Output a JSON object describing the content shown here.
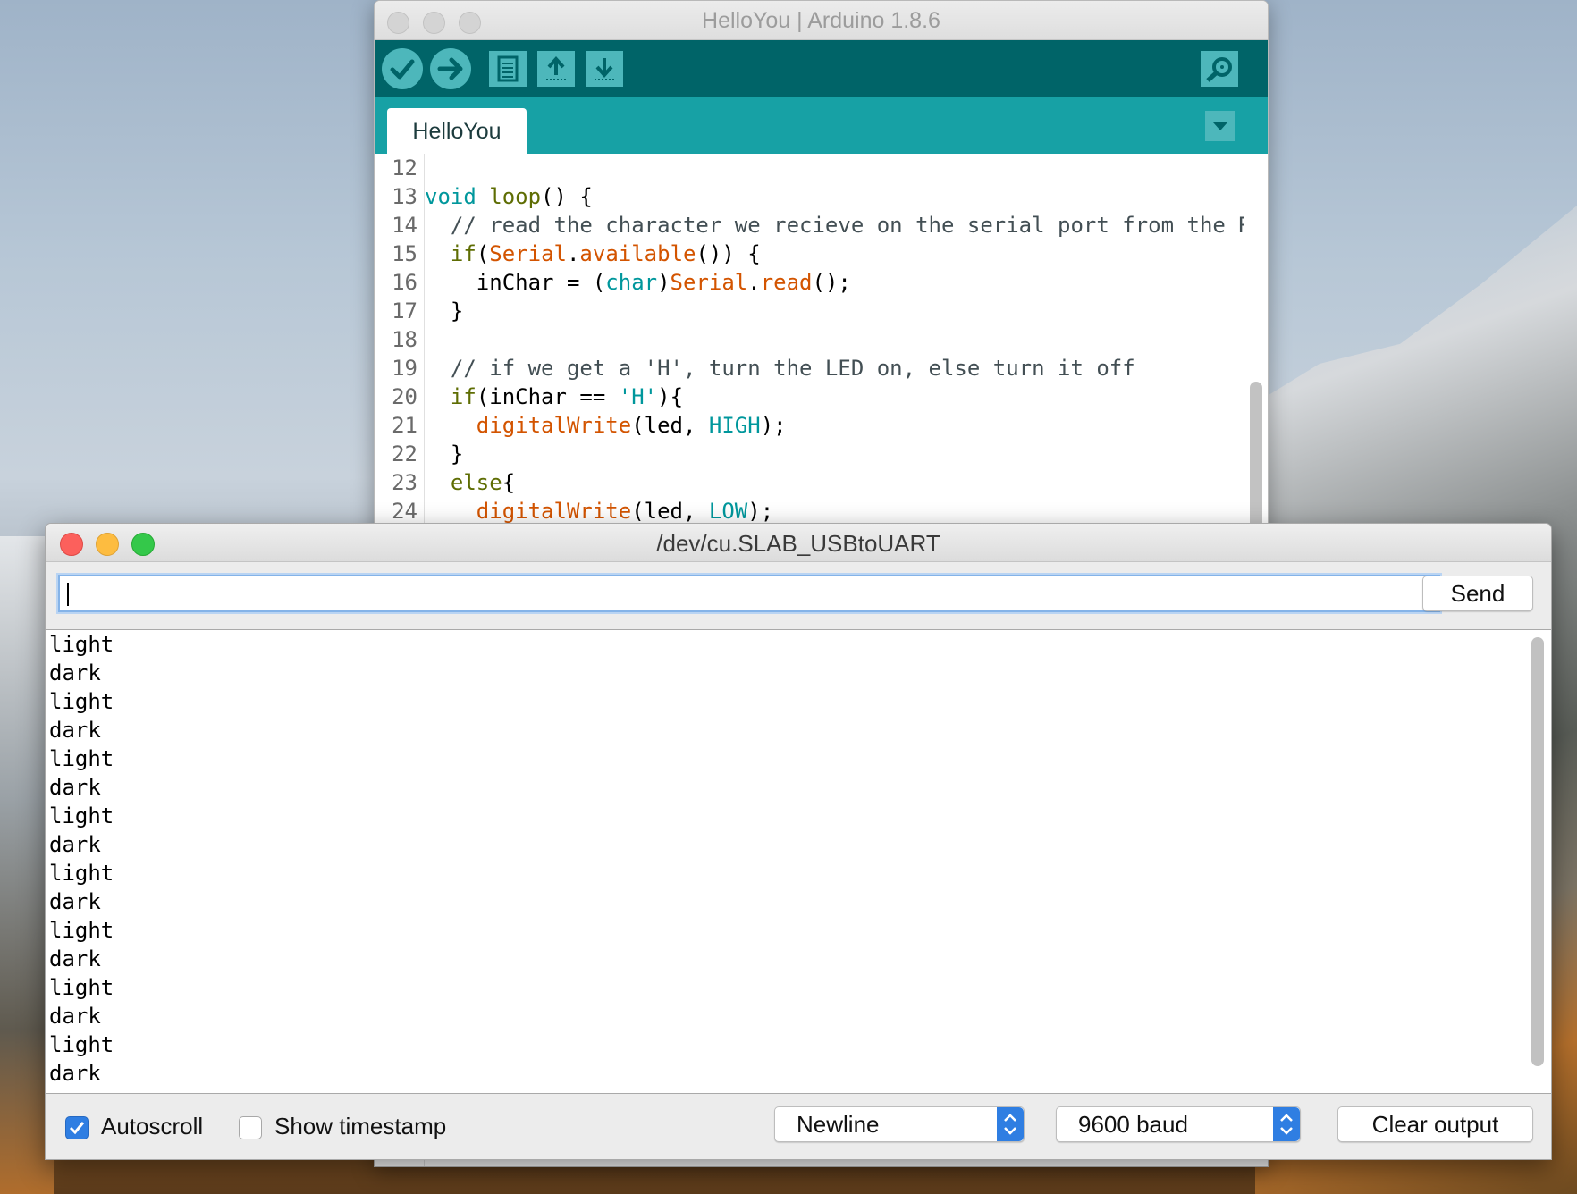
{
  "arduino": {
    "window_title": "HelloYou | Arduino 1.8.6",
    "tab_label": "HelloYou",
    "toolbar": {
      "verify_icon": "checkmark-icon",
      "upload_icon": "right-arrow-icon",
      "new_icon": "new-sketch-icon",
      "open_icon": "open-up-arrow-icon",
      "save_icon": "save-down-arrow-icon",
      "serial_monitor_icon": "magnifier-icon"
    },
    "line_numbers": [
      "12",
      "13",
      "14",
      "15",
      "16",
      "17",
      "18",
      "19",
      "20",
      "21",
      "22",
      "23",
      "24"
    ],
    "code_lines": [
      [
        {
          "t": "",
          "c": "pl"
        }
      ],
      [
        {
          "t": "void",
          "c": "ty"
        },
        {
          "t": " ",
          "c": "pl"
        },
        {
          "t": "loop",
          "c": "kw"
        },
        {
          "t": "() {",
          "c": "pl"
        }
      ],
      [
        {
          "t": "  // read the character we recieve on the serial port from the RP",
          "c": "cm"
        }
      ],
      [
        {
          "t": "  ",
          "c": "pl"
        },
        {
          "t": "if",
          "c": "kw"
        },
        {
          "t": "(",
          "c": "pl"
        },
        {
          "t": "Serial",
          "c": "fn"
        },
        {
          "t": ".",
          "c": "pl"
        },
        {
          "t": "available",
          "c": "fn"
        },
        {
          "t": "()) {",
          "c": "pl"
        }
      ],
      [
        {
          "t": "    inChar = (",
          "c": "pl"
        },
        {
          "t": "char",
          "c": "ty"
        },
        {
          "t": ")",
          "c": "pl"
        },
        {
          "t": "Serial",
          "c": "fn"
        },
        {
          "t": ".",
          "c": "pl"
        },
        {
          "t": "read",
          "c": "fn"
        },
        {
          "t": "();",
          "c": "pl"
        }
      ],
      [
        {
          "t": "  }",
          "c": "pl"
        }
      ],
      [
        {
          "t": "",
          "c": "pl"
        }
      ],
      [
        {
          "t": "  // if we get a 'H', turn the LED on, else turn it off",
          "c": "cm"
        }
      ],
      [
        {
          "t": "  ",
          "c": "pl"
        },
        {
          "t": "if",
          "c": "kw"
        },
        {
          "t": "(inChar == ",
          "c": "pl"
        },
        {
          "t": "'H'",
          "c": "ty"
        },
        {
          "t": "){",
          "c": "pl"
        }
      ],
      [
        {
          "t": "    ",
          "c": "pl"
        },
        {
          "t": "digitalWrite",
          "c": "fn"
        },
        {
          "t": "(led, ",
          "c": "pl"
        },
        {
          "t": "HIGH",
          "c": "ty"
        },
        {
          "t": ");",
          "c": "pl"
        }
      ],
      [
        {
          "t": "  }",
          "c": "pl"
        }
      ],
      [
        {
          "t": "  ",
          "c": "pl"
        },
        {
          "t": "else",
          "c": "kw"
        },
        {
          "t": "{",
          "c": "pl"
        }
      ],
      [
        {
          "t": "    ",
          "c": "pl"
        },
        {
          "t": "digitalWrite",
          "c": "fn"
        },
        {
          "t": "(led, ",
          "c": "pl"
        },
        {
          "t": "LOW",
          "c": "ty"
        },
        {
          "t": ");",
          "c": "pl"
        }
      ]
    ]
  },
  "serial_monitor": {
    "window_title": "/dev/cu.SLAB_USBtoUART",
    "input_value": "",
    "send_label": "Send",
    "output_lines": [
      "light",
      "dark",
      "light",
      "dark",
      "light",
      "dark",
      "light",
      "dark",
      "light",
      "dark",
      "light",
      "dark",
      "light",
      "dark",
      "light",
      "dark"
    ],
    "autoscroll_label": "Autoscroll",
    "autoscroll_checked": true,
    "timestamp_label": "Show timestamp",
    "timestamp_checked": false,
    "line_ending": "Newline",
    "baud_rate": "9600 baud",
    "clear_label": "Clear output"
  },
  "colors": {
    "toolbar": "#006468",
    "tabbar": "#17a1a5",
    "button": "#4db7bb",
    "close": "#fc605c",
    "minimize": "#fdbc40",
    "maximize": "#34c84a",
    "accent": "#2f7ee2"
  }
}
